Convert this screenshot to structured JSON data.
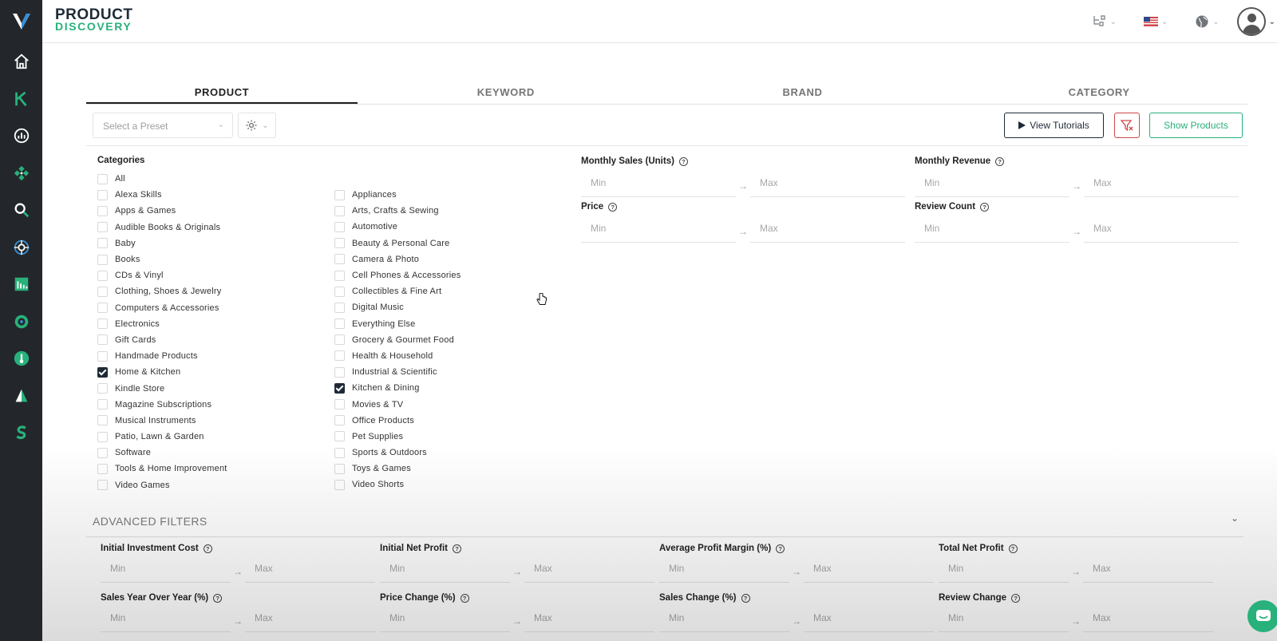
{
  "brand": {
    "line1": "PRODUCT",
    "line2": "DISCOVERY"
  },
  "colors": {
    "accent": "#28b17b",
    "sidebar": "#23272b",
    "danger": "#d0464b",
    "navy": "#1f2a37"
  },
  "sidebar": {
    "items": [
      {
        "icon": "home-icon"
      },
      {
        "icon": "keyword-k-icon"
      },
      {
        "icon": "analytics-icon"
      },
      {
        "icon": "diamond-grid-icon"
      },
      {
        "icon": "magnifier-icon"
      },
      {
        "icon": "target-icon"
      },
      {
        "icon": "bar-chart-icon"
      },
      {
        "icon": "radar-icon"
      },
      {
        "icon": "thermometer-icon"
      },
      {
        "icon": "triangle-icon"
      },
      {
        "icon": "s-logo-icon"
      }
    ]
  },
  "tabs": [
    {
      "label": "PRODUCT",
      "active": true
    },
    {
      "label": "KEYWORD",
      "active": false
    },
    {
      "label": "BRAND",
      "active": false
    },
    {
      "label": "CATEGORY",
      "active": false
    }
  ],
  "toolbar": {
    "preset_placeholder": "Select a Preset",
    "tutorials_label": "View Tutorials",
    "show_label": "Show Products"
  },
  "categories": {
    "title": "Categories",
    "col1": [
      {
        "label": "All",
        "checked": false
      },
      {
        "label": "Alexa Skills",
        "checked": false
      },
      {
        "label": "Apps & Games",
        "checked": false
      },
      {
        "label": "Audible Books & Originals",
        "checked": false
      },
      {
        "label": "Baby",
        "checked": false
      },
      {
        "label": "Books",
        "checked": false
      },
      {
        "label": "CDs & Vinyl",
        "checked": false
      },
      {
        "label": "Clothing, Shoes & Jewelry",
        "checked": false
      },
      {
        "label": "Computers & Accessories",
        "checked": false
      },
      {
        "label": "Electronics",
        "checked": false
      },
      {
        "label": "Gift Cards",
        "checked": false
      },
      {
        "label": "Handmade Products",
        "checked": false
      },
      {
        "label": "Home & Kitchen",
        "checked": true
      },
      {
        "label": "Kindle Store",
        "checked": false
      },
      {
        "label": "Magazine Subscriptions",
        "checked": false
      },
      {
        "label": "Musical Instruments",
        "checked": false
      },
      {
        "label": "Patio, Lawn & Garden",
        "checked": false
      },
      {
        "label": "Software",
        "checked": false
      },
      {
        "label": "Tools & Home Improvement",
        "checked": false
      },
      {
        "label": "Video Games",
        "checked": false
      }
    ],
    "col2": [
      {
        "label": "Appliances",
        "checked": false
      },
      {
        "label": "Arts, Crafts & Sewing",
        "checked": false
      },
      {
        "label": "Automotive",
        "checked": false
      },
      {
        "label": "Beauty & Personal Care",
        "checked": false
      },
      {
        "label": "Camera & Photo",
        "checked": false
      },
      {
        "label": "Cell Phones & Accessories",
        "checked": false
      },
      {
        "label": "Collectibles & Fine Art",
        "checked": false
      },
      {
        "label": "Digital Music",
        "checked": false
      },
      {
        "label": "Everything Else",
        "checked": false
      },
      {
        "label": "Grocery & Gourmet Food",
        "checked": false
      },
      {
        "label": "Health & Household",
        "checked": false
      },
      {
        "label": "Industrial & Scientific",
        "checked": false
      },
      {
        "label": "Kitchen & Dining",
        "checked": true
      },
      {
        "label": "Movies & TV",
        "checked": false
      },
      {
        "label": "Office Products",
        "checked": false
      },
      {
        "label": "Pet Supplies",
        "checked": false
      },
      {
        "label": "Sports & Outdoors",
        "checked": false
      },
      {
        "label": "Toys & Games",
        "checked": false
      },
      {
        "label": "Video Shorts",
        "checked": false
      }
    ]
  },
  "filters": {
    "monthly_sales": "Monthly Sales (Units)",
    "monthly_revenue": "Monthly Revenue",
    "price": "Price",
    "review_count": "Review Count",
    "min": "Min",
    "max": "Max",
    "arrow": "→",
    "help": "?"
  },
  "advanced": {
    "title": "ADVANCED FILTERS",
    "row1": [
      "Initial Investment Cost",
      "Initial Net Profit",
      "Average Profit Margin (%)",
      "Total Net Profit"
    ],
    "row2": [
      "Sales Year Over Year (%)",
      "Price Change (%)",
      "Sales Change (%)",
      "Review Change"
    ]
  }
}
